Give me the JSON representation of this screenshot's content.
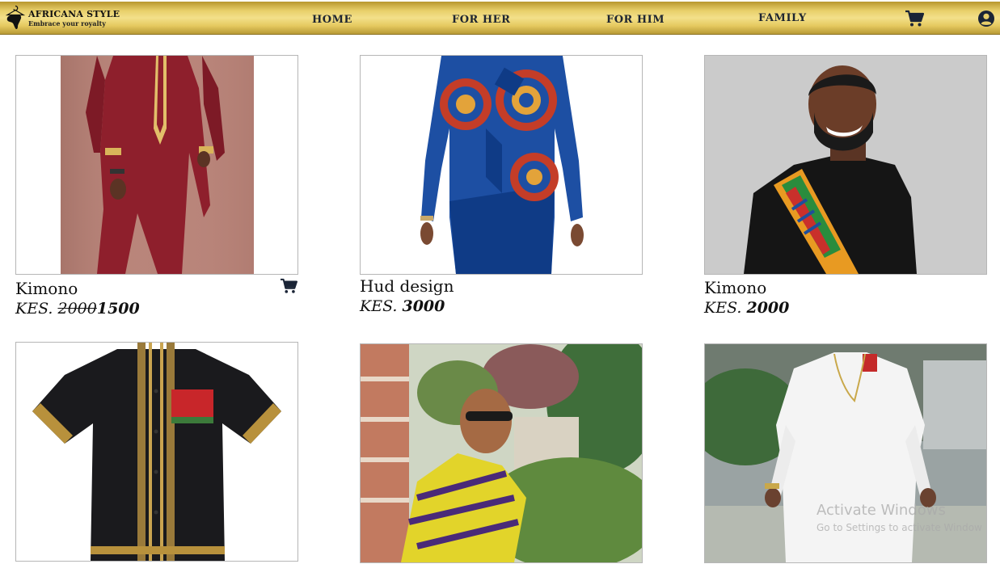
{
  "brand": {
    "name": "AFRICANA STYLE",
    "tagline": "Embrace your royalty"
  },
  "nav": {
    "items": [
      {
        "label": "HOME"
      },
      {
        "label": "FOR HER"
      },
      {
        "label": "FOR HIM"
      },
      {
        "label": "FAMILY"
      }
    ],
    "cart_icon": "shopping-cart-icon",
    "account_icon": "user-circle-icon"
  },
  "products": [
    {
      "name": "Kimono",
      "currency": "KES. ",
      "old_price": "2000",
      "price": "1500",
      "image": "burgundy-kaftan-with-gold-trim"
    },
    {
      "name": "Hud design",
      "currency": "KES. ",
      "old_price": "",
      "price": "3000",
      "image": "blue-ankara-print-long-sleeve-shirt"
    },
    {
      "name": "Kimono",
      "currency": "KES. ",
      "old_price": "",
      "price": "2000",
      "image": "black-tee-with-kente-sash"
    },
    {
      "name": "",
      "currency": "",
      "old_price": "",
      "price": "",
      "image": "black-kente-trim-short-sleeve-shirt"
    },
    {
      "name": "",
      "currency": "",
      "old_price": "",
      "price": "",
      "image": "yellow-purple-print-shirt-man-in-garden"
    },
    {
      "name": "",
      "currency": "",
      "old_price": "",
      "price": "",
      "image": "white-senator-outfit"
    }
  ],
  "watermark": {
    "title": "Activate Windows",
    "subtitle": "Go to Settings to activate Window"
  },
  "colors": {
    "nav_gold": "#e8cf6a",
    "nav_text": "#1e2530",
    "icon_navy": "#1a2436"
  }
}
